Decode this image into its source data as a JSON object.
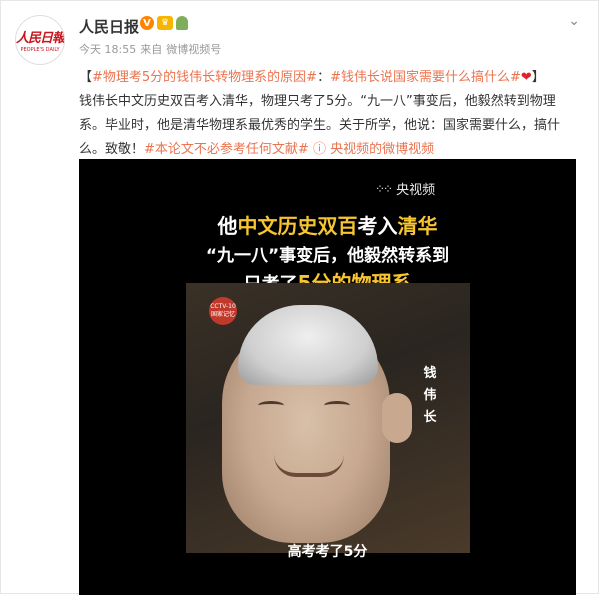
{
  "account": {
    "name": "人民日报",
    "logo_text": "人民日報",
    "logo_sub": "PEOPLE'S DAILY",
    "verified_badge": "V",
    "time": "今天 18:55",
    "source_prefix": "来自",
    "source": "微博视频号",
    "menu_icon": "chevron-down-icon"
  },
  "post": {
    "open_bracket": "【",
    "topic1": "#物理考5分的钱伟长转物理系的原因#",
    "colon": "：",
    "topic2": "#钱伟长说国家需要什么搞什么#",
    "close_bracket": "】",
    "body": "钱伟长中文历史双百考入清华，物理只考了5分。“九一八”事变后，他毅然转到物理系。毕业时，他是清华物理系最优秀的学生。关于所学，他说：国家需要什么，搞什么。致敬！",
    "topic3": "#本论文不必参考任何文献#",
    "video_link": "央视频的微博视频"
  },
  "video": {
    "watermark": "央视频",
    "caption1_pre": "他",
    "caption1_hl": "中文历史双百",
    "caption1_mid": "考入",
    "caption1_post": "清华",
    "caption2": "“九一八”事变后，他毅然转系到",
    "caption3_pre": "只考了",
    "caption3_hl": "5分的物理系",
    "channel_logo_top": "CCTV-10",
    "channel_logo_bottom": "国家记忆",
    "name_vertical": "钱伟长",
    "bottom_caption": "高考考了5分"
  },
  "colors": {
    "link": "#eb7350",
    "highlight": "#f7c531",
    "accent": "#ff8200"
  }
}
